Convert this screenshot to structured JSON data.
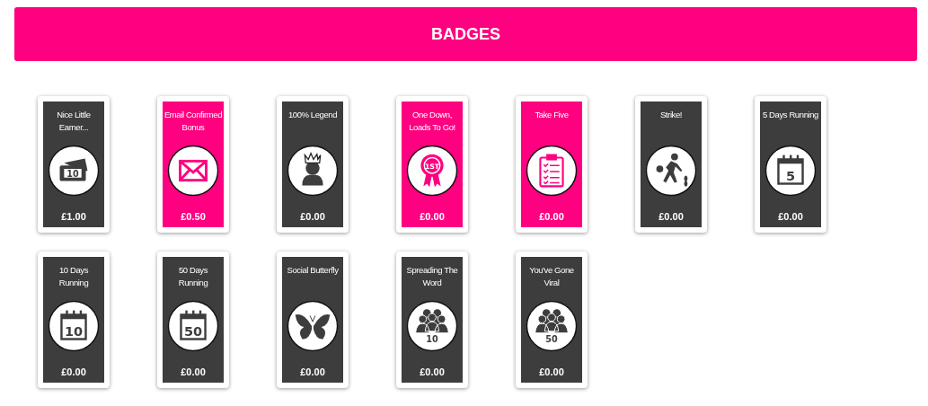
{
  "header": {
    "title": "BADGES"
  },
  "badges": [
    {
      "title": "Nice Little Earner...",
      "kind": "money",
      "icon_text": "10",
      "earned": false,
      "amount": "£1.00"
    },
    {
      "title": "Email Confirmed Bonus",
      "kind": "envelope",
      "earned": true,
      "amount": "£0.50"
    },
    {
      "title": "100% Legend",
      "kind": "crown",
      "earned": false,
      "amount": "£0.00"
    },
    {
      "title": "One Down, Loads To Go!",
      "kind": "ribbon",
      "icon_text": "1ST",
      "earned": true,
      "amount": "£0.00"
    },
    {
      "title": "Take Five",
      "kind": "clipboard",
      "earned": true,
      "amount": "£0.00"
    },
    {
      "title": "Strike!",
      "kind": "bowler",
      "earned": false,
      "amount": "£0.00"
    },
    {
      "title": "5 Days Running",
      "kind": "calendar",
      "icon_text": "5",
      "earned": false,
      "amount": "£0.00"
    },
    {
      "title": "10 Days Running",
      "kind": "calendar",
      "icon_text": "10",
      "earned": false,
      "amount": "£0.00"
    },
    {
      "title": "50 Days Running",
      "kind": "calendar",
      "icon_text": "50",
      "earned": false,
      "amount": "£0.00"
    },
    {
      "title": "Social Butterfly",
      "kind": "butterfly",
      "earned": false,
      "amount": "£0.00"
    },
    {
      "title": "Spreading The Word",
      "kind": "crowd",
      "icon_text": "10",
      "earned": false,
      "amount": "£0.00"
    },
    {
      "title": "You've Gone Viral",
      "kind": "crowd",
      "icon_text": "50",
      "earned": false,
      "amount": "£0.00"
    }
  ]
}
